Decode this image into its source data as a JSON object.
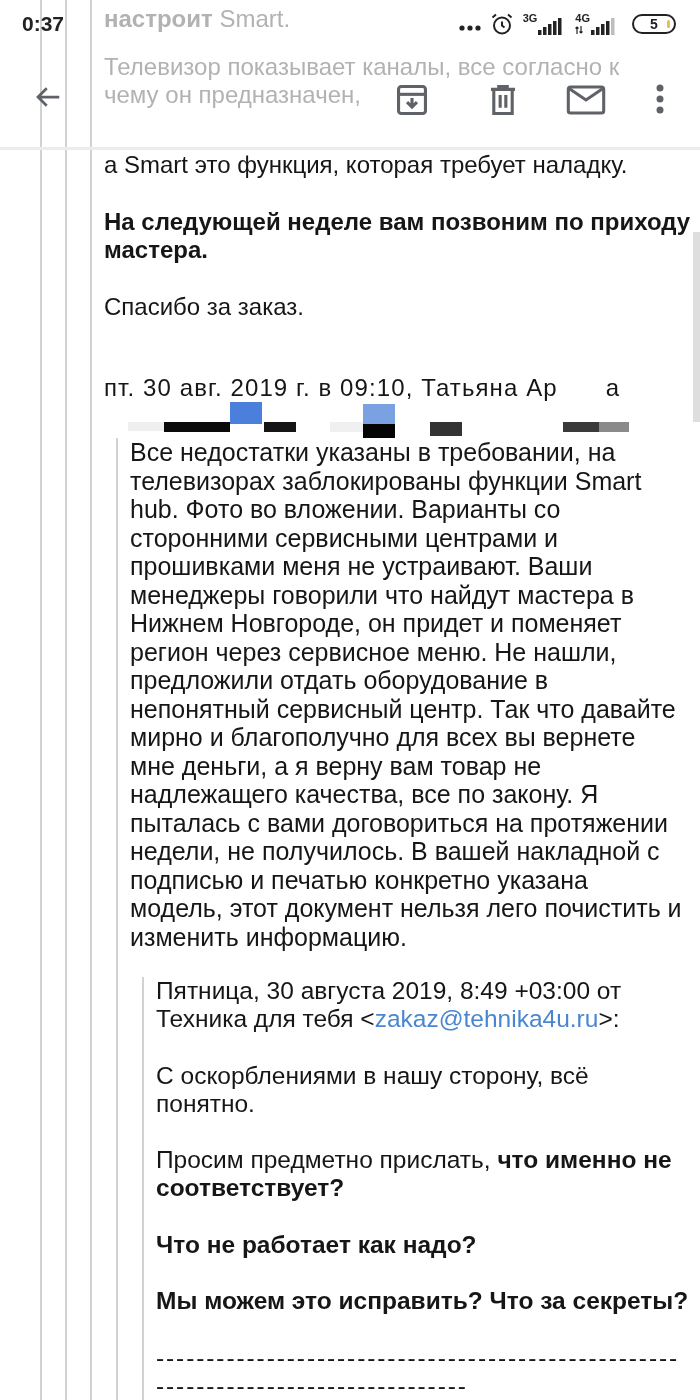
{
  "status_bar": {
    "time": "0:37",
    "network_1": "3G",
    "network_2": "4G",
    "battery": "5"
  },
  "faded_text": {
    "lines": [
      "**настроит** Smart.",
      "Телевизор показывает каналы, все согласно к",
      "чему он предназначен,"
    ]
  },
  "message": {
    "paragraphs": [
      {
        "kind": "plain",
        "text": "а Smart это функция, которая требует наладку."
      },
      {
        "kind": "bold",
        "text": "На следующей неделе вам позвоним по приходу мастера."
      },
      {
        "kind": "plain",
        "text": "Спасибо за заказ."
      }
    ],
    "quote_header": {
      "text": "пт. 30 авг. 2019 г. в 09:10, Татьяна Ар",
      "tail": "а"
    }
  },
  "quote": {
    "text": "Все недостатки указаны в требовании, на телевизорах заблокированы функции Smart hub. Фото во вложении. Варианты со сторонними сервисными центрами и прошивками меня не устраивают. Ваши менеджеры говорили что найдут мастера в Нижнем Новгороде, он придет и поменяет регион через сервисное меню. Не нашли, предложили отдать оборудование в непонятный сервисный центр. Так что давайте мирно и благополучно для всех вы вернете мне деньги, а я верну вам товар не надлежащего качества, все по закону. Я пыталась с вами договориться на протяжении недели, не получилось. В вашей накладной с подписью и печатью конкретно указана модель, этот документ нельзя лего почистить и изменить информацию."
  },
  "inner_quote": {
    "header": {
      "before": "Пятница, 30 августа 2019, 8:49 +03:00 от Техника для тебя <",
      "email": "zakaz@tehnika4u.ru",
      "after": ">:"
    },
    "paragraphs": [
      {
        "kind": "plain",
        "text": "С оскорблениями в нашу сторону, всё понятно."
      },
      {
        "kind": "plain",
        "text": "Просим предметно прислать, **что именно не соответствует?**"
      },
      {
        "kind": "bold",
        "text": "Что не работает как надо?"
      },
      {
        "kind": "bold",
        "text": "Мы можем это исправить? Что за секреты?"
      },
      {
        "kind": "separator",
        "text": "-----------------------------------------------------------------------------------"
      }
    ]
  }
}
